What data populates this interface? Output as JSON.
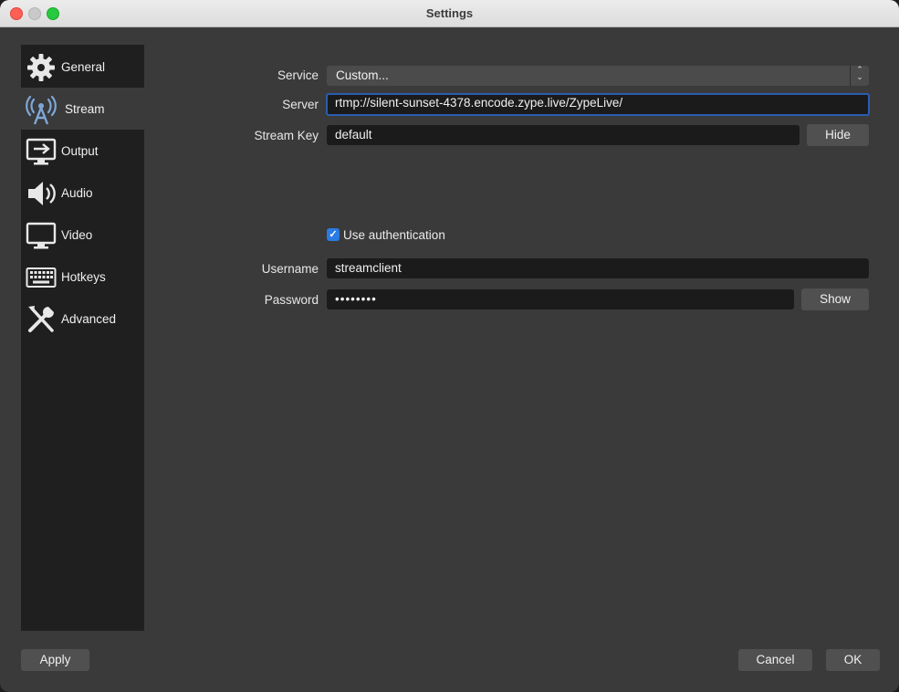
{
  "window": {
    "title": "Settings"
  },
  "sidebar": {
    "items": [
      {
        "label": "General",
        "icon": "gear-icon"
      },
      {
        "label": "Stream",
        "icon": "antenna-icon",
        "active": true
      },
      {
        "label": "Output",
        "icon": "output-icon"
      },
      {
        "label": "Audio",
        "icon": "speaker-icon"
      },
      {
        "label": "Video",
        "icon": "monitor-icon"
      },
      {
        "label": "Hotkeys",
        "icon": "keyboard-icon"
      },
      {
        "label": "Advanced",
        "icon": "tools-icon"
      }
    ]
  },
  "stream": {
    "service_label": "Service",
    "service_value": "Custom...",
    "server_label": "Server",
    "server_value": "rtmp://silent-sunset-4378.encode.zype.live/ZypeLive/",
    "key_label": "Stream Key",
    "key_value": "default",
    "hide_button": "Hide",
    "use_auth_label": "Use authentication",
    "use_auth_checked": true,
    "username_label": "Username",
    "username_value": "streamclient",
    "password_label": "Password",
    "password_value": "••••••••",
    "show_button": "Show"
  },
  "footer": {
    "apply": "Apply",
    "cancel": "Cancel",
    "ok": "OK"
  },
  "colors": {
    "accent": "#2a7be4",
    "focus_border": "#2a5db0",
    "sidebar_bg": "#1f1f1f",
    "panel_bg": "#3a3a3a"
  }
}
